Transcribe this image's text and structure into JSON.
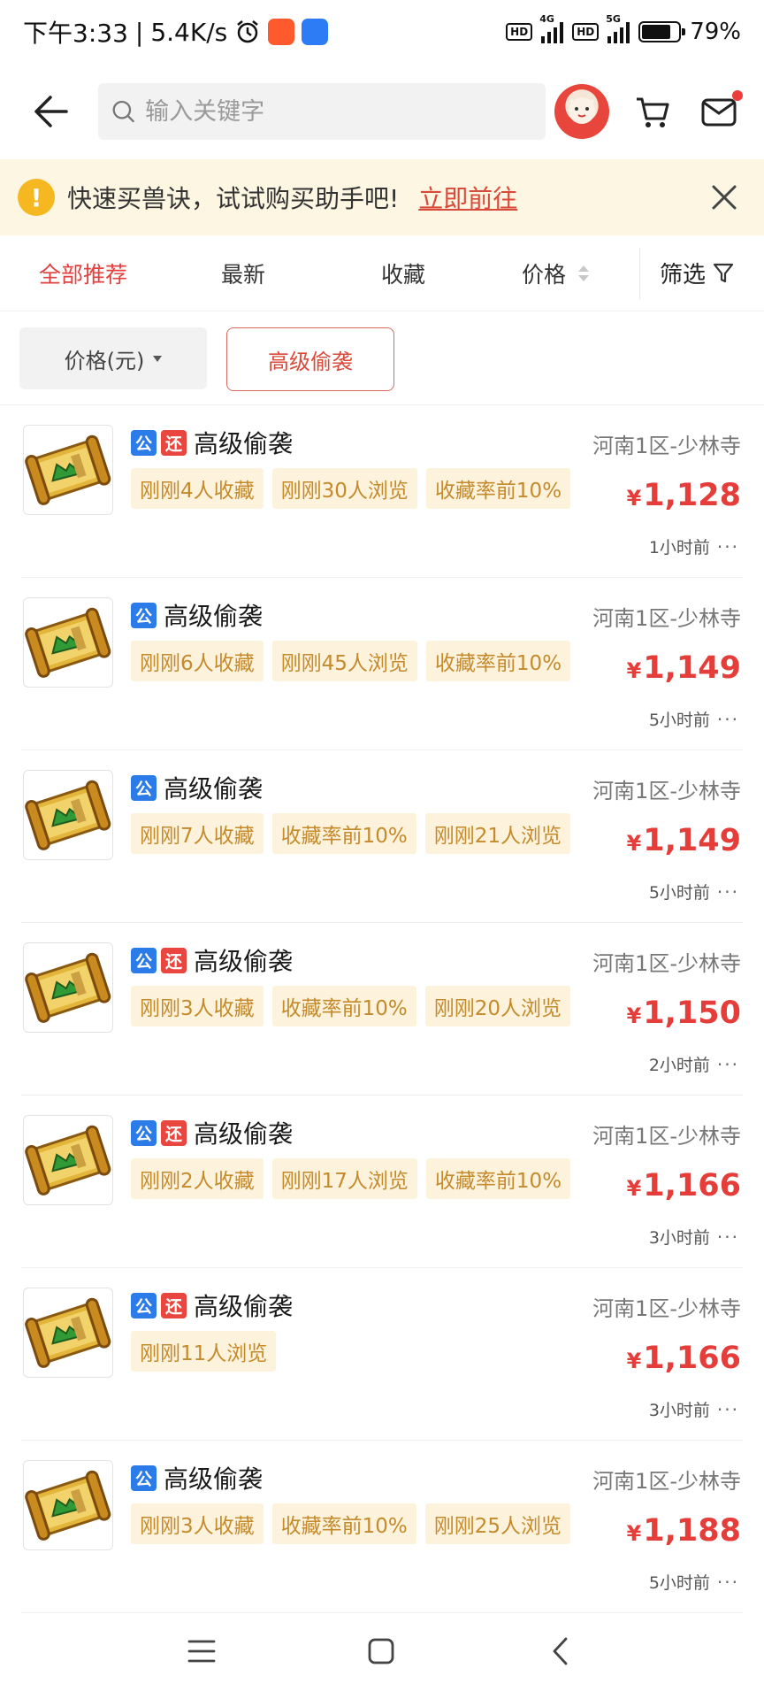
{
  "status_bar": {
    "time": "下午3:33",
    "separator": "|",
    "speed": "5.4K/s",
    "hd1": "HD",
    "net1": "4G",
    "hd2": "HD",
    "net2": "5G",
    "battery_percent": "79%",
    "battery_level": 0.79
  },
  "header": {
    "search_placeholder": "输入关键字",
    "icons": [
      "back-arrow-icon",
      "search-icon",
      "avatar",
      "cart-icon",
      "message-icon"
    ]
  },
  "banner": {
    "text": "快速买兽诀，试试购买助手吧!",
    "link": "立即前往"
  },
  "tabs": {
    "all": "全部推荐",
    "latest": "最新",
    "favorites": "收藏",
    "price": "价格",
    "filter": "筛选"
  },
  "chips": {
    "price_chip": "价格(元)",
    "skill_chip": "高级偷袭"
  },
  "items": [
    {
      "badges": [
        "公",
        "还"
      ],
      "title": "高级偷袭",
      "server": "河南1区-少林寺",
      "tags": [
        "刚刚4人收藏",
        "刚刚30人浏览",
        "收藏率前10%"
      ],
      "currency": "¥",
      "price": "1,128",
      "time": "1小时前"
    },
    {
      "badges": [
        "公"
      ],
      "title": "高级偷袭",
      "server": "河南1区-少林寺",
      "tags": [
        "刚刚6人收藏",
        "刚刚45人浏览",
        "收藏率前10%"
      ],
      "currency": "¥",
      "price": "1,149",
      "time": "5小时前"
    },
    {
      "badges": [
        "公"
      ],
      "title": "高级偷袭",
      "server": "河南1区-少林寺",
      "tags": [
        "刚刚7人收藏",
        "收藏率前10%",
        "刚刚21人浏览"
      ],
      "currency": "¥",
      "price": "1,149",
      "time": "5小时前"
    },
    {
      "badges": [
        "公",
        "还"
      ],
      "title": "高级偷袭",
      "server": "河南1区-少林寺",
      "tags": [
        "刚刚3人收藏",
        "收藏率前10%",
        "刚刚20人浏览"
      ],
      "currency": "¥",
      "price": "1,150",
      "time": "2小时前"
    },
    {
      "badges": [
        "公",
        "还"
      ],
      "title": "高级偷袭",
      "server": "河南1区-少林寺",
      "tags": [
        "刚刚2人收藏",
        "刚刚17人浏览",
        "收藏率前10%"
      ],
      "currency": "¥",
      "price": "1,166",
      "time": "3小时前"
    },
    {
      "badges": [
        "公",
        "还"
      ],
      "title": "高级偷袭",
      "server": "河南1区-少林寺",
      "tags": [
        "刚刚11人浏览"
      ],
      "currency": "¥",
      "price": "1,166",
      "time": "3小时前"
    },
    {
      "badges": [
        "公"
      ],
      "title": "高级偷袭",
      "server": "河南1区-少林寺",
      "tags": [
        "刚刚3人收藏",
        "收藏率前10%",
        "刚刚25人浏览"
      ],
      "currency": "¥",
      "price": "1,188",
      "time": "5小时前"
    }
  ],
  "more_glyph": "···",
  "nav": [
    "menu-icon",
    "home-icon",
    "back-icon"
  ],
  "colors": {
    "accent": "#e53d3a",
    "tag_bg": "#fdf3dc",
    "tag_text": "#c48a2c",
    "badge_pub": "#2b7be9",
    "badge_ret": "#e8463f",
    "banner_bg": "#fdf6e2"
  }
}
